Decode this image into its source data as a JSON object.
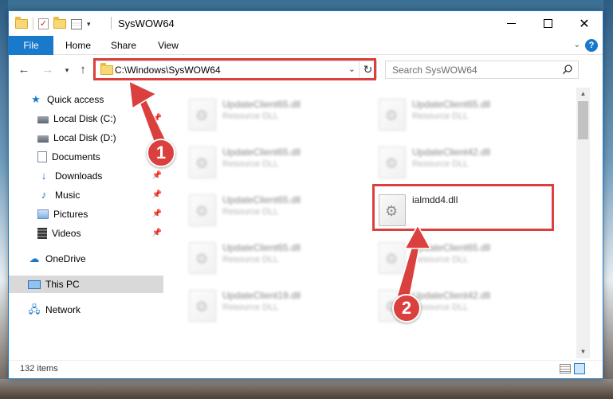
{
  "window": {
    "title": "SysWOW64",
    "controls": {
      "minimize": "—",
      "maximize": "☐",
      "close": "✕"
    }
  },
  "ribbon": {
    "tabs": [
      "File",
      "Home",
      "Share",
      "View"
    ],
    "help": "?"
  },
  "address": {
    "path": "C:\\Windows\\SysWOW64",
    "search_placeholder": "Search SysWOW64"
  },
  "nav_pane": {
    "quick_access": "Quick access",
    "items": [
      {
        "label": "Local Disk (C:)",
        "icon": "disk-icon",
        "pinned": true
      },
      {
        "label": "Local Disk (D:)",
        "icon": "disk-icon",
        "pinned": false
      },
      {
        "label": "Documents",
        "icon": "documents-icon",
        "pinned": true
      },
      {
        "label": "Downloads",
        "icon": "downloads-icon",
        "pinned": true
      },
      {
        "label": "Music",
        "icon": "music-icon",
        "pinned": true
      },
      {
        "label": "Pictures",
        "icon": "pictures-icon",
        "pinned": true
      },
      {
        "label": "Videos",
        "icon": "videos-icon",
        "pinned": true
      }
    ],
    "onedrive": "OneDrive",
    "this_pc": "This PC",
    "network": "Network"
  },
  "files": {
    "col1": [
      {
        "name": "UpdateClient65.dll",
        "type": "Resource DLL"
      },
      {
        "name": "UpdateClient65.dll",
        "type": "Resource DLL"
      },
      {
        "name": "UpdateClient65.dll",
        "type": "Resource DLL"
      },
      {
        "name": "UpdateClient65.dll",
        "type": "Resource DLL"
      },
      {
        "name": "UpdateClient19.dll",
        "type": "Resource DLL"
      }
    ],
    "col2": [
      {
        "name": "UpdateClient65.dll",
        "type": "Resource DLL"
      },
      {
        "name": "UpdateClient42.dll",
        "type": "Resource DLL"
      },
      {
        "name": "ialmdd4.dll",
        "type": ""
      },
      {
        "name": "UpdateClient65.dll",
        "type": "Resource DLL"
      },
      {
        "name": "UpdateClient42.dll",
        "type": "Resource DLL"
      }
    ]
  },
  "status": {
    "item_count": "132 items"
  },
  "annotations": {
    "callout_1": "1",
    "callout_2": "2",
    "color": "#d9403e"
  },
  "colors": {
    "accent": "#1979ca",
    "highlight": "#d9403e"
  }
}
